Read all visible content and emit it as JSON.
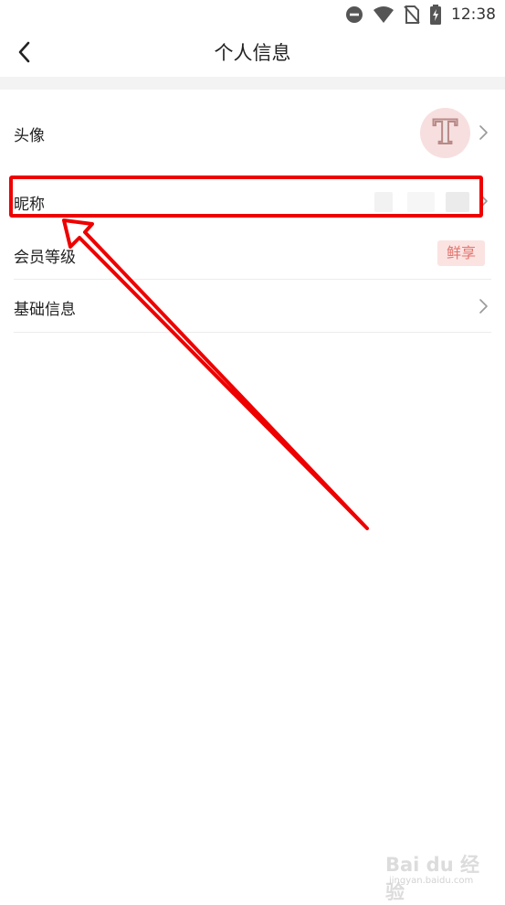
{
  "status_bar": {
    "time": "12:38",
    "icons": [
      "do-not-disturb-icon",
      "wifi-icon",
      "no-sim-icon",
      "battery-charging-icon"
    ]
  },
  "header": {
    "back_icon": "chevron-left-icon",
    "title": "个人信息"
  },
  "rows": [
    {
      "key": "avatar",
      "label": "头像",
      "avatar_letter": "T"
    },
    {
      "key": "nickname",
      "label": "昵称"
    },
    {
      "key": "member_level",
      "label": "会员等级",
      "badge": "鲜享"
    },
    {
      "key": "basic_info",
      "label": "基础信息"
    }
  ],
  "colors": {
    "annotation_red": "#ee0000",
    "badge_bg": "#fbe3e2",
    "badge_text": "#e2756f",
    "avatar_bg": "#f7dfe0",
    "divider": "#f3f3f3"
  },
  "watermark": {
    "main": "Bai du 经验",
    "sub": "jingyan.baidu.com"
  }
}
